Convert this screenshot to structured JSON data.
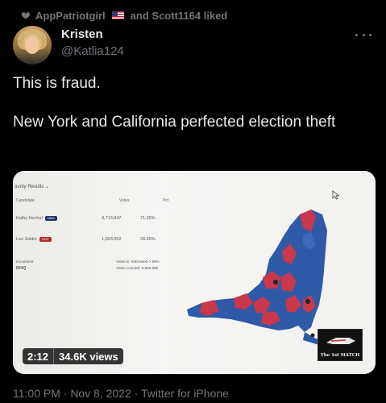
{
  "social_context": {
    "user1": "AppPatriotgirl",
    "flag_icon": "us-flag-icon",
    "rest": "and Scott1164 liked"
  },
  "author": {
    "name": "Kristen",
    "handle": "@Katlia124"
  },
  "tweet": {
    "text": "This is fraud.\n\nNew York and California perfected election theft"
  },
  "video": {
    "duration": "2:12",
    "views": "34.6K views",
    "screen": {
      "header": "ounty Results",
      "col_candidate": "Candidate",
      "col_votes": "Votes",
      "col_pct": "Pct",
      "candidates": [
        {
          "name": "Kathy Hochul",
          "party": "DEM",
          "votes": "4,713,847",
          "pct": "71.35%"
        },
        {
          "name": "Lee Zeldin",
          "party": "GOP",
          "votes": "1,893,052",
          "pct": "28.65%"
        }
      ],
      "incumbent": "Incumbent",
      "hq": "DHQ",
      "estimated": "Votes in: Estimated > 99%",
      "counted": "Votes counted: 6,606,899",
      "watermark": "The 1st MATCH"
    }
  },
  "timestamp": "11:00 PM · Nov 8, 2022 · Twitter for iPhone",
  "colors": {
    "background": "#000000",
    "text": "#e7e9ea",
    "muted": "#71767b",
    "dem_blue": "#2e5aa8",
    "gop_red": "#c8374a"
  }
}
